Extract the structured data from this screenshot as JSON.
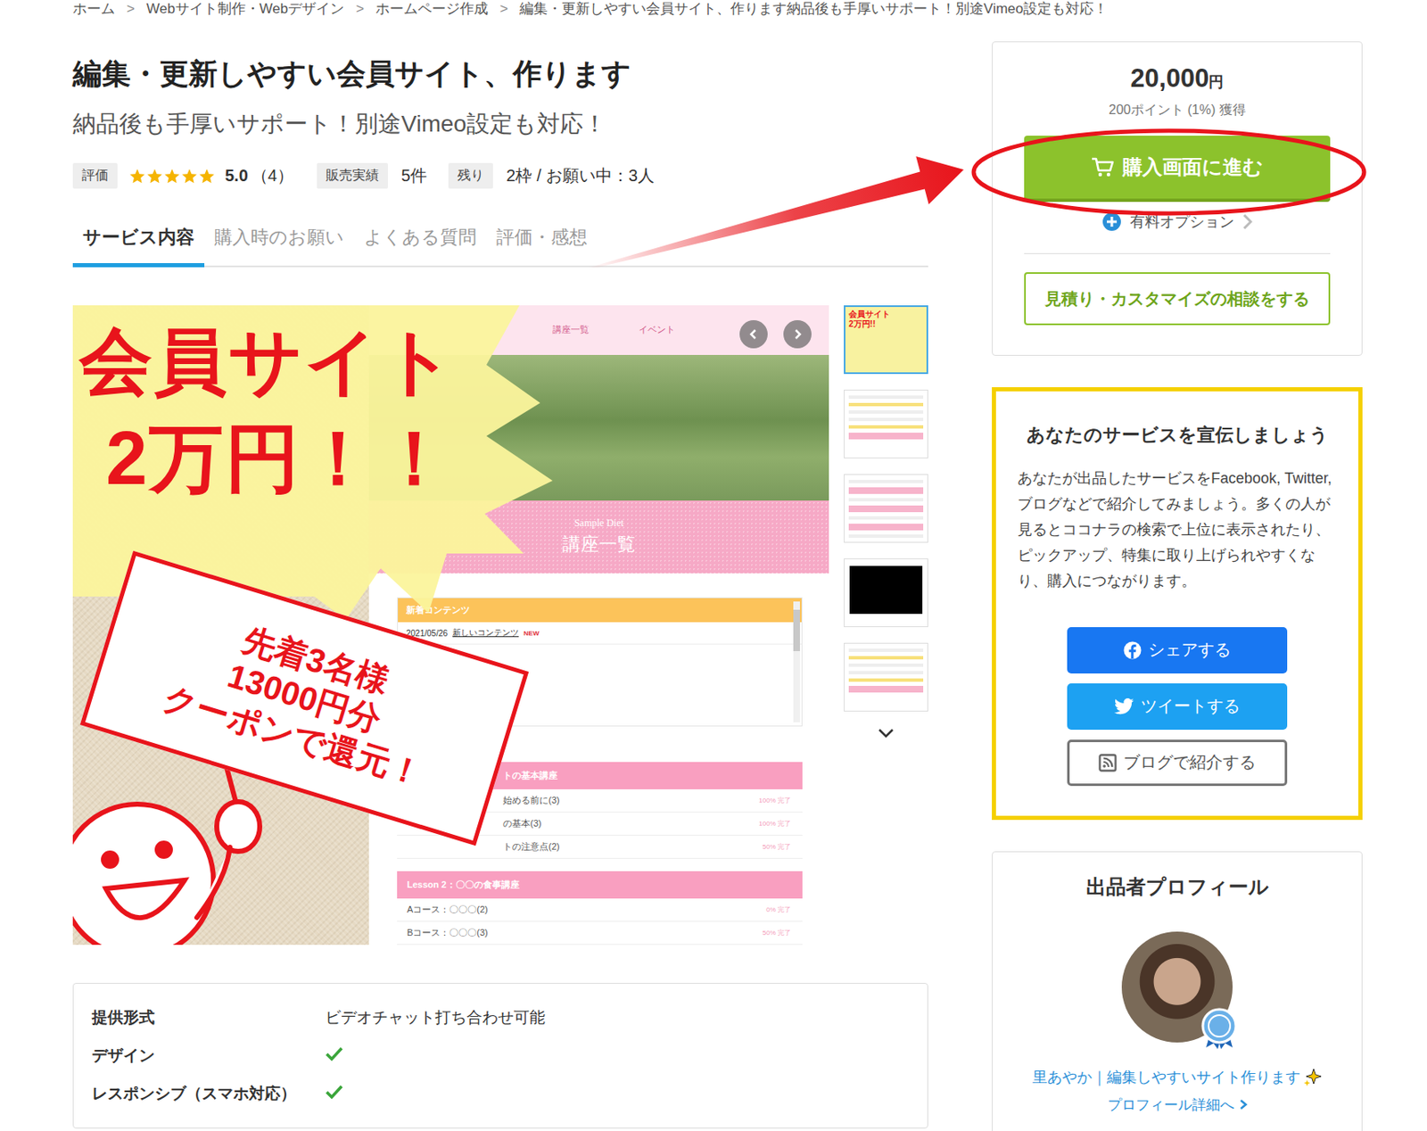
{
  "breadcrumb": {
    "items": [
      "ホーム",
      "Webサイト制作・Webデザイン",
      "ホームページ作成",
      "編集・更新しやすい会員サイト、作ります納品後も手厚いサポート！別途Vimeo設定も対応！"
    ],
    "separator": ">"
  },
  "title": "編集・更新しやすい会員サイト、作ります",
  "subtitle": "納品後も手厚いサポート！別途Vimeo設定も対応！",
  "meta": {
    "rating_label": "評価",
    "stars": 5,
    "rating": "5.0",
    "review_count": "（4）",
    "sales_label": "販売実績",
    "sales": "5件",
    "remaining_label": "残り",
    "remaining": "2枠 / お願い中：3人"
  },
  "tabs": [
    {
      "label": "サービス内容",
      "selected": true
    },
    {
      "label": "購入時のお願い",
      "selected": false
    },
    {
      "label": "よくある質問",
      "selected": false
    },
    {
      "label": "評価・感想",
      "selected": false
    }
  ],
  "gallery": {
    "promo": {
      "headline": "会員サイト",
      "price": "2万円！！",
      "sign": [
        "先着3名様",
        "13000円分",
        "クーポンで還元！"
      ]
    },
    "mock": {
      "nav": [
        "講座一覧",
        "イベント"
      ],
      "brand": "Sample Diet",
      "page_title": "講座一覧",
      "news": {
        "title": "新着コンテンツ",
        "date": "2021/05/26",
        "link": "新しいコンテンツ",
        "badge": "NEW"
      },
      "sections": [
        {
          "kind": "covered",
          "title": "トの基本講座",
          "rows": [
            {
              "label": "始める前に(3)",
              "progress": "100% 完了"
            },
            {
              "label": "の基本(3)",
              "progress": "100% 完了"
            },
            {
              "label": "トの注意点(2)",
              "progress": "50% 完了"
            }
          ]
        },
        {
          "kind": "plain",
          "title": "Lesson 2：〇〇の食事講座",
          "rows": [
            {
              "label": "Aコース：〇〇〇(2)",
              "progress": "0% 完了"
            },
            {
              "label": "Bコース：〇〇〇(3)",
              "progress": "50% 完了"
            }
          ]
        }
      ]
    },
    "thumbnails": [
      {
        "kind": "promo",
        "selected": true,
        "lines": [
          "会員サイト",
          "2万円!!"
        ]
      },
      {
        "kind": "page",
        "selected": false
      },
      {
        "kind": "list",
        "selected": false
      },
      {
        "kind": "video",
        "selected": false
      },
      {
        "kind": "page",
        "selected": false
      }
    ]
  },
  "specs": [
    {
      "kind": "text",
      "label": "提供形式",
      "value": "ビデオチャット打ち合わせ可能"
    },
    {
      "kind": "check",
      "label": "デザイン",
      "checked": true
    },
    {
      "kind": "check",
      "label": "レスポンシブ（スマホ対応）",
      "checked": true
    }
  ],
  "purchase": {
    "price": "20,000",
    "currency": "円",
    "points": "200ポイント (1%) 獲得",
    "buy_button": "購入画面に進む",
    "options": "有料オプション",
    "consult_button": "見積り・カスタマイズの相談をする"
  },
  "promote": {
    "title": "あなたのサービスを宣伝しましょう",
    "body": "あなたが出品したサービスをFacebook, Twitter, ブログなどで紹介してみましょう。多くの人が見るとココナラの検索で上位に表示されたり、ピックアップ、特集に取り上げられやすくなり、購入につながります。",
    "buttons": [
      {
        "kind": "facebook",
        "label": "シェアする"
      },
      {
        "kind": "twitter",
        "label": "ツイートする"
      },
      {
        "kind": "blog",
        "label": "ブログで紹介する"
      }
    ]
  },
  "profile": {
    "heading": "出品者プロフィール",
    "name": "里あやか｜編集しやすいサイト作ります",
    "link": "プロフィール詳細へ"
  }
}
